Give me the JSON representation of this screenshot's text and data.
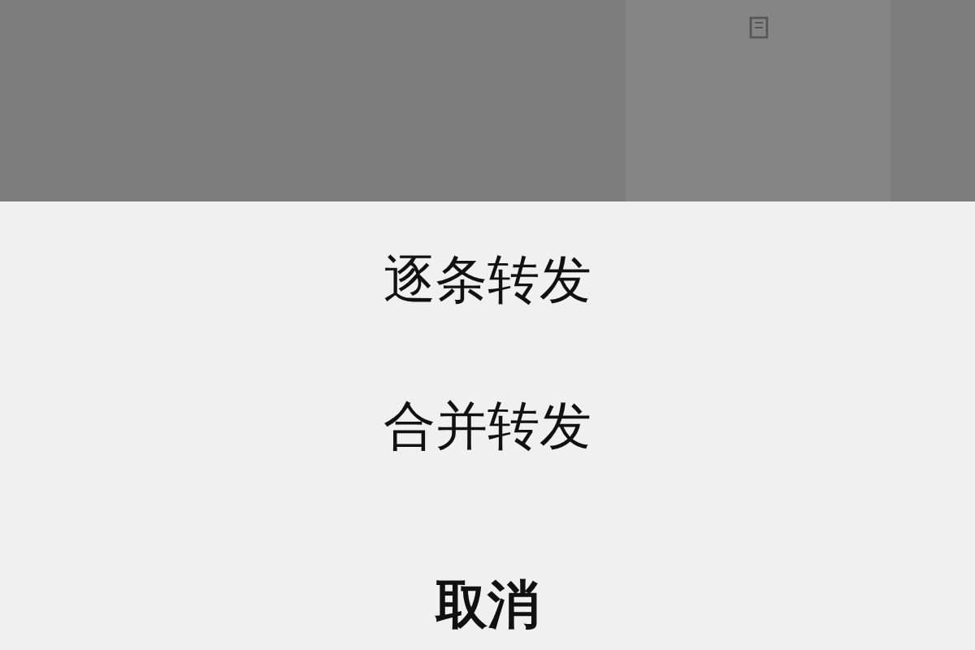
{
  "action_sheet": {
    "options": [
      {
        "label": "逐条转发"
      },
      {
        "label": "合并转发"
      }
    ],
    "cancel": {
      "label": "取消"
    }
  }
}
